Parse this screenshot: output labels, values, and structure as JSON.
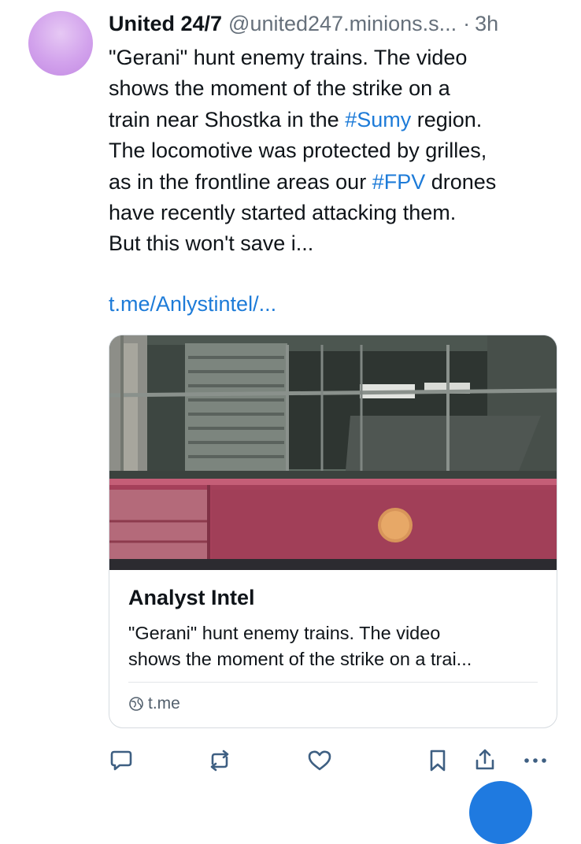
{
  "post": {
    "author": {
      "name": "United 24/7",
      "handle": "@united247.minions.s...",
      "separator": "·",
      "time": "3h"
    },
    "text": {
      "l1": "\"Gerani\" hunt enemy trains. The video",
      "l2": "shows the moment of the strike on a",
      "l3_a": "train near Shostka in the ",
      "l3_tag": "#Sumy",
      "l3_b": " region.",
      "l4": "The locomotive was protected by grilles,",
      "l5_a": "as in the frontline areas our ",
      "l5_tag": "#FPV",
      "l5_b": " drones",
      "l6": "have recently started attacking them.",
      "l7": "But this won't save i..."
    },
    "link": "t.me/Anlystintel/..."
  },
  "card": {
    "title": "Analyst Intel",
    "description_l1": "\"Gerani\" hunt enemy trains. The video",
    "description_l2": "shows the moment of the strike on a trai...",
    "domain": "t.me",
    "domain_icon": "globe-icon"
  },
  "actions": {
    "icons": [
      "reply-icon",
      "repost-icon",
      "like-icon",
      "bookmark-icon",
      "share-icon",
      "more-icon"
    ]
  },
  "colors": {
    "link": "#1d7bd8",
    "muted": "#66707b",
    "avatar": "#d2a2ec",
    "fab": "#1f7ae0"
  }
}
